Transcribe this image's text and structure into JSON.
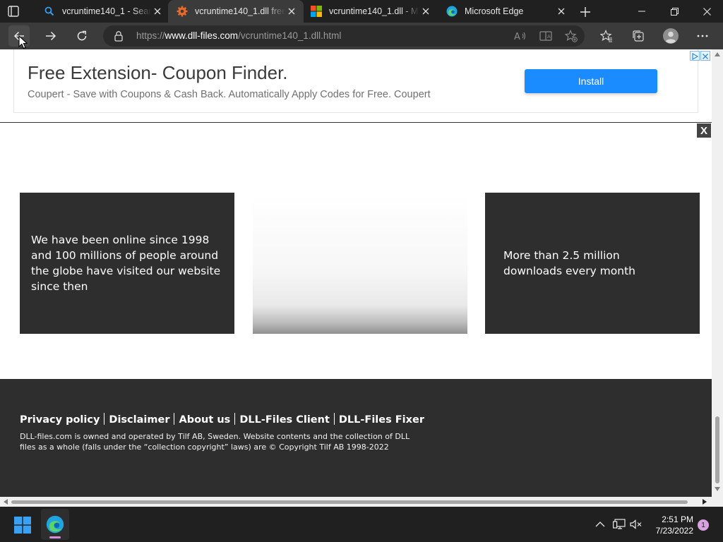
{
  "browser": {
    "tabs": [
      {
        "title": "vcruntime140_1 - Search",
        "favicon": "search-icon",
        "active": false
      },
      {
        "title": "vcruntime140_1.dll free",
        "favicon": "dll-files-gear-icon",
        "active": true
      },
      {
        "title": "vcruntime140_1.dll - Mi",
        "favicon": "microsoft-logo-icon",
        "active": false
      },
      {
        "title": "Microsoft Edge",
        "favicon": "edge-logo-icon",
        "active": false
      }
    ],
    "address": {
      "scheme": "https://",
      "host": "www.dll-files.com",
      "path": "/vcruntime140_1.dll.html"
    }
  },
  "ad": {
    "title": "Free Extension- Coupon Finder.",
    "description": "Coupert - Save with Coupons & Cash Back. Automatically Apply Codes for Free. Coupert",
    "button": "Install",
    "accent": "#1a8cff"
  },
  "overlay_close": "X",
  "cards": [
    {
      "text": "We have been online since 1998 and 100 millions of people around the globe have visited our website since then"
    },
    {
      "text": ""
    },
    {
      "text": "More than 2.5 million downloads every month"
    }
  ],
  "footer": {
    "links": [
      "Privacy policy",
      "Disclaimer",
      "About us",
      "DLL-Files Client",
      "DLL-Files Fixer"
    ],
    "copyright": "DLL-files.com is owned and operated by Tilf AB, Sweden. Website contents and the collection of DLL files as a whole (falls under the “collection copyright” laws) are © Copyright Tilf AB 1998-2022"
  },
  "taskbar": {
    "time": "2:51 PM",
    "date": "7/23/2022",
    "notifications": "1"
  }
}
